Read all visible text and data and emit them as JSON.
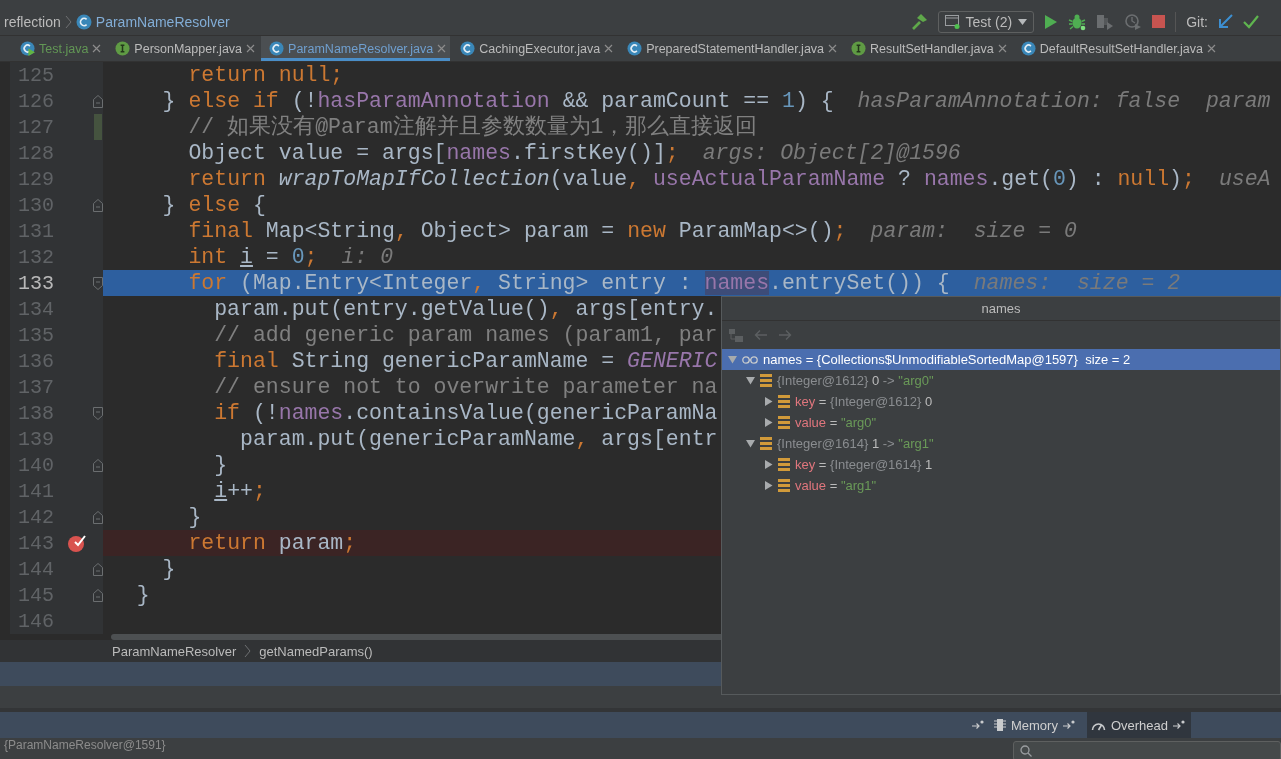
{
  "nav_bar": {
    "path": [
      {
        "label": "reflection",
        "kind": "package"
      },
      {
        "label": "ParamNameResolver",
        "kind": "class"
      }
    ],
    "run_config": "Test (2)",
    "vcs_label": "Git:"
  },
  "tabs": [
    {
      "label": "Test.java",
      "kind": "runnable",
      "color": "#629755",
      "selected": false
    },
    {
      "label": "PersonMapper.java",
      "kind": "interface",
      "color": "#bbbbbb",
      "selected": false
    },
    {
      "label": "ParamNameResolver.java",
      "kind": "class",
      "color": "#6f9fcf",
      "selected": true
    },
    {
      "label": "CachingExecutor.java",
      "kind": "class",
      "color": "#bbbbbb",
      "selected": false
    },
    {
      "label": "PreparedStatementHandler.java",
      "kind": "class",
      "color": "#bbbbbb",
      "selected": false
    },
    {
      "label": "ResultSetHandler.java",
      "kind": "interface",
      "color": "#bbbbbb",
      "selected": false
    },
    {
      "label": "DefaultResultSetHandler.java",
      "kind": "class",
      "color": "#bbbbbb",
      "selected": false
    }
  ],
  "editor": {
    "lines": [
      {
        "number": "125",
        "kind": "plain",
        "breakpoint": false,
        "current": false,
        "changed": false,
        "tokens": [
          {
            "kind": "keyword",
            "text": "      return null;"
          }
        ]
      },
      {
        "number": "126",
        "kind": "closing",
        "breakpoint": false,
        "current": false,
        "changed": false,
        "tokens": [
          {
            "kind": "plain",
            "text": "    } "
          },
          {
            "kind": "keyword",
            "text": "else if"
          },
          {
            "kind": "plain",
            "text": " (!"
          },
          {
            "kind": "field",
            "text": "hasParamAnnotation"
          },
          {
            "kind": "plain",
            "text": " && paramCount == "
          },
          {
            "kind": "number",
            "text": "1"
          },
          {
            "kind": "plain",
            "text": ") {"
          }
        ],
        "hint": "hasParamAnnotation: false  param"
      },
      {
        "number": "127",
        "kind": "plain",
        "breakpoint": false,
        "current": false,
        "changed": true,
        "tokens": [
          {
            "kind": "comment",
            "text": "      // 如果没有@Param注解并且参数数量为1，那么直接返回"
          }
        ]
      },
      {
        "number": "128",
        "kind": "plain",
        "breakpoint": false,
        "current": false,
        "changed": false,
        "tokens": [
          {
            "kind": "plain",
            "text": "      Object value = args["
          },
          {
            "kind": "field",
            "text": "names"
          },
          {
            "kind": "plain",
            "text": ".firstKey()]"
          },
          {
            "kind": "keyword",
            "text": ";"
          }
        ],
        "hint": "args: Object[2]@1596"
      },
      {
        "number": "129",
        "kind": "plain",
        "breakpoint": false,
        "current": false,
        "changed": false,
        "tokens": [
          {
            "kind": "keyword",
            "text": "      return "
          },
          {
            "kind": "static",
            "text": "wrapToMapIfCollection"
          },
          {
            "kind": "plain",
            "text": "(value"
          },
          {
            "kind": "keyword",
            "text": ","
          },
          {
            "kind": "field",
            "text": " useActualParamName"
          },
          {
            "kind": "plain",
            "text": " ? "
          },
          {
            "kind": "field",
            "text": "names"
          },
          {
            "kind": "plain",
            "text": ".get("
          },
          {
            "kind": "number",
            "text": "0"
          },
          {
            "kind": "plain",
            "text": ") : "
          },
          {
            "kind": "keyword",
            "text": "null"
          },
          {
            "kind": "plain",
            "text": ")"
          },
          {
            "kind": "keyword",
            "text": ";"
          }
        ],
        "hint": "useA"
      },
      {
        "number": "130",
        "kind": "closing",
        "breakpoint": false,
        "current": false,
        "changed": false,
        "tokens": [
          {
            "kind": "plain",
            "text": "    } "
          },
          {
            "kind": "keyword",
            "text": "else"
          },
          {
            "kind": "plain",
            "text": " {"
          }
        ]
      },
      {
        "number": "131",
        "kind": "plain",
        "breakpoint": false,
        "current": false,
        "changed": false,
        "tokens": [
          {
            "kind": "keyword",
            "text": "      final"
          },
          {
            "kind": "plain",
            "text": " Map<String"
          },
          {
            "kind": "keyword",
            "text": ","
          },
          {
            "kind": "plain",
            "text": " Object> param = "
          },
          {
            "kind": "keyword",
            "text": "new"
          },
          {
            "kind": "plain",
            "text": " ParamMap<>()"
          },
          {
            "kind": "keyword",
            "text": ";"
          }
        ],
        "hint": "param:  size = 0"
      },
      {
        "number": "132",
        "kind": "plain",
        "breakpoint": false,
        "current": false,
        "changed": false,
        "tokens": [
          {
            "kind": "keyword",
            "text": "      int"
          },
          {
            "kind": "var",
            "text": " i"
          },
          {
            "kind": "plain",
            "text": " = "
          },
          {
            "kind": "number",
            "text": "0"
          },
          {
            "kind": "keyword",
            "text": ";"
          }
        ],
        "hint": "i: 0"
      },
      {
        "number": "133",
        "kind": "opening",
        "breakpoint": false,
        "current": true,
        "changed": false,
        "tokens": [
          {
            "kind": "keyword",
            "text": "      for"
          },
          {
            "kind": "plain",
            "text": " (Map.Entry<Integer"
          },
          {
            "kind": "keyword",
            "text": ","
          },
          {
            "kind": "plain",
            "text": " String> entry : "
          },
          {
            "kind": "usage",
            "text": "names"
          },
          {
            "kind": "plain",
            "text": ".entrySet()) {"
          }
        ],
        "hint": "names:  size = 2"
      },
      {
        "number": "134",
        "kind": "plain",
        "breakpoint": false,
        "current": false,
        "changed": false,
        "tokens": [
          {
            "kind": "plain",
            "text": "        param.put(entry.getValue()"
          },
          {
            "kind": "keyword",
            "text": ","
          },
          {
            "kind": "plain",
            "text": " args[entry."
          }
        ]
      },
      {
        "number": "135",
        "kind": "plain",
        "breakpoint": false,
        "current": false,
        "changed": false,
        "tokens": [
          {
            "kind": "comment",
            "text": "        // add generic param names (param1, par"
          }
        ]
      },
      {
        "number": "136",
        "kind": "plain",
        "breakpoint": false,
        "current": false,
        "changed": false,
        "tokens": [
          {
            "kind": "keyword",
            "text": "        final"
          },
          {
            "kind": "plain",
            "text": " String genericParamName = "
          },
          {
            "kind": "constant",
            "text": "GENERIC"
          }
        ]
      },
      {
        "number": "137",
        "kind": "plain",
        "breakpoint": false,
        "current": false,
        "changed": false,
        "tokens": [
          {
            "kind": "comment",
            "text": "        // ensure not to overwrite parameter na"
          }
        ]
      },
      {
        "number": "138",
        "kind": "opening",
        "breakpoint": false,
        "current": false,
        "changed": false,
        "tokens": [
          {
            "kind": "keyword",
            "text": "        if"
          },
          {
            "kind": "plain",
            "text": " (!"
          },
          {
            "kind": "field",
            "text": "names"
          },
          {
            "kind": "plain",
            "text": ".containsValue(genericParamNa"
          }
        ]
      },
      {
        "number": "139",
        "kind": "plain",
        "breakpoint": false,
        "current": false,
        "changed": false,
        "tokens": [
          {
            "kind": "plain",
            "text": "          param.put(genericParamName"
          },
          {
            "kind": "keyword",
            "text": ","
          },
          {
            "kind": "plain",
            "text": " args[entr"
          }
        ]
      },
      {
        "number": "140",
        "kind": "closing",
        "breakpoint": false,
        "current": false,
        "changed": false,
        "tokens": [
          {
            "kind": "plain",
            "text": "        }"
          }
        ]
      },
      {
        "number": "141",
        "kind": "plain",
        "breakpoint": false,
        "current": false,
        "changed": false,
        "tokens": [
          {
            "kind": "var",
            "text": "        i"
          },
          {
            "kind": "plain",
            "text": "++"
          },
          {
            "kind": "keyword",
            "text": ";"
          }
        ]
      },
      {
        "number": "142",
        "kind": "closing",
        "breakpoint": false,
        "current": false,
        "changed": false,
        "tokens": [
          {
            "kind": "plain",
            "text": "      }"
          }
        ]
      },
      {
        "number": "143",
        "kind": "plain",
        "breakpoint": true,
        "current": false,
        "changed": false,
        "tokens": [
          {
            "kind": "keyword",
            "text": "      return"
          },
          {
            "kind": "plain",
            "text": " param"
          },
          {
            "kind": "keyword",
            "text": ";"
          }
        ]
      },
      {
        "number": "144",
        "kind": "closing",
        "breakpoint": false,
        "current": false,
        "changed": false,
        "tokens": [
          {
            "kind": "plain",
            "text": "    }"
          }
        ]
      },
      {
        "number": "145",
        "kind": "closing",
        "breakpoint": false,
        "current": false,
        "changed": false,
        "tokens": [
          {
            "kind": "plain",
            "text": "  }"
          }
        ]
      },
      {
        "number": "146",
        "kind": "plain",
        "breakpoint": false,
        "current": false,
        "changed": false
      }
    ],
    "breadcrumbs": [
      "ParamNameResolver",
      "getNamedParams()"
    ]
  },
  "popup": {
    "title": "names",
    "toolbar": [
      {
        "kind": "tree",
        "disabled": true
      },
      {
        "kind": "back",
        "disabled": true
      },
      {
        "kind": "forward",
        "disabled": true
      }
    ],
    "tree": [
      {
        "kind": "watch",
        "expanded": true,
        "selected": true,
        "parts": [
          {
            "kind": "plain",
            "text": "names = {Collections$UnmodifiableSortedMap@1597}  size = 2"
          }
        ],
        "children": [
          {
            "kind": "field",
            "expanded": true,
            "selected": false,
            "parts": [
              {
                "kind": "ref",
                "text": "{Integer@1612}"
              },
              {
                "kind": "plain",
                "text": " 0 "
              },
              {
                "kind": "ref",
                "text": "-> "
              },
              {
                "kind": "string",
                "text": "\"arg0\""
              }
            ],
            "children": [
              {
                "kind": "field",
                "expanded": false,
                "selected": false,
                "parts": [
                  {
                    "kind": "name",
                    "text": "key"
                  },
                  {
                    "kind": "plain",
                    "text": " = "
                  },
                  {
                    "kind": "ref",
                    "text": "{Integer@1612}"
                  },
                  {
                    "kind": "plain",
                    "text": " 0"
                  }
                ]
              },
              {
                "kind": "field",
                "expanded": false,
                "selected": false,
                "parts": [
                  {
                    "kind": "name",
                    "text": "value"
                  },
                  {
                    "kind": "plain",
                    "text": " = "
                  },
                  {
                    "kind": "string",
                    "text": "\"arg0\""
                  }
                ]
              }
            ]
          },
          {
            "kind": "field",
            "expanded": true,
            "selected": false,
            "parts": [
              {
                "kind": "ref",
                "text": "{Integer@1614}"
              },
              {
                "kind": "plain",
                "text": " 1 "
              },
              {
                "kind": "ref",
                "text": "-> "
              },
              {
                "kind": "string",
                "text": "\"arg1\""
              }
            ],
            "children": [
              {
                "kind": "field",
                "expanded": false,
                "selected": false,
                "parts": [
                  {
                    "kind": "name",
                    "text": "key"
                  },
                  {
                    "kind": "plain",
                    "text": " = "
                  },
                  {
                    "kind": "ref",
                    "text": "{Integer@1614}"
                  },
                  {
                    "kind": "plain",
                    "text": " 1"
                  }
                ]
              },
              {
                "kind": "field",
                "expanded": false,
                "selected": false,
                "parts": [
                  {
                    "kind": "name",
                    "text": "value"
                  },
                  {
                    "kind": "plain",
                    "text": " = "
                  },
                  {
                    "kind": "string",
                    "text": "\"arg1\""
                  }
                ]
              }
            ]
          }
        ]
      }
    ]
  },
  "debugger": {
    "tabs": [
      {
        "label": "Memory",
        "kind": "memory",
        "selected": false
      },
      {
        "label": "Overhead",
        "kind": "overhead",
        "selected": true
      }
    ],
    "frame": "{ParamNameResolver@1591}"
  }
}
